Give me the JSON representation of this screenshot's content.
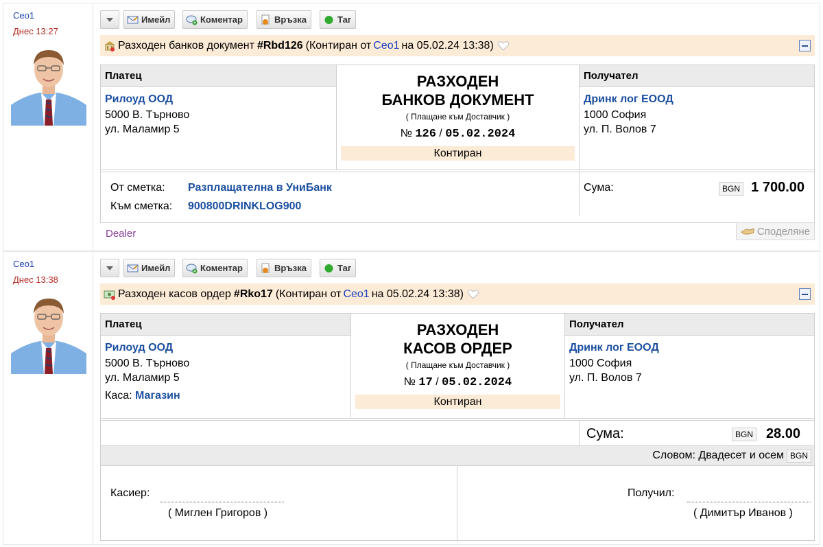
{
  "entries": [
    {
      "author": "Ceo1",
      "time": "Днес 13:27",
      "toolbar": {
        "email": "Имейл",
        "comment": "Коментар",
        "link": "Връзка",
        "tag": "Таг"
      },
      "header": {
        "doc_type": "Разходен банков документ",
        "doc_id": "#Rbd126",
        "status_prefix": "(Контиран от",
        "user": "Ceo1",
        "on": "на 05.02.24 13:38)"
      },
      "payer": {
        "head": "Платец",
        "name": "Рилоуд ООД",
        "line1": "5000 В. Търново",
        "line2": "ул. Маламир 5"
      },
      "title1": "РАЗХОДЕН",
      "title2": "БАНКОВ ДОКУМЕНТ",
      "subtitle": "( Плащане към Доставчик )",
      "num_sign": "№",
      "number": "126",
      "slash": "/",
      "date": "05.02.2024",
      "state": "Контиран",
      "recipient": {
        "head": "Получател",
        "name": "Дринк лог ЕООД",
        "line1": "1000 София",
        "line2": "ул. П. Волов 7"
      },
      "from_label": "От сметка:",
      "from_value": "Разплащателна в УниБанк",
      "to_label": "Към сметка:",
      "to_value": "900800DRINKLOG900",
      "sum_label": "Сума:",
      "currency": "BGN",
      "amount": "1 700.00",
      "dealer": "Dealer",
      "share": "Споделяне"
    },
    {
      "author": "Ceo1",
      "time": "Днес 13:38",
      "toolbar": {
        "email": "Имейл",
        "comment": "Коментар",
        "link": "Връзка",
        "tag": "Таг"
      },
      "header": {
        "doc_type": "Разходен касов ордер",
        "doc_id": "#Rko17",
        "status_prefix": "(Контиран от",
        "user": "Ceo1",
        "on": "на 05.02.24 13:38)"
      },
      "payer": {
        "head": "Платец",
        "name": "Рилоуд ООД",
        "line1": "5000 В. Търново",
        "line2": "ул. Маламир 5",
        "cash_label": "Каса:",
        "cash_value": "Магазин"
      },
      "title1": "РАЗХОДЕН",
      "title2": "КАСОВ ОРДЕР",
      "subtitle": "( Плащане към Доставчик )",
      "num_sign": "№",
      "number": "17",
      "slash": "/",
      "date": "05.02.2024",
      "state": "Контиран",
      "recipient": {
        "head": "Получател",
        "name": "Дринк лог ЕООД",
        "line1": "1000 София",
        "line2": "ул. П. Волов 7"
      },
      "sum_label": "Сума:",
      "currency": "BGN",
      "amount": "28.00",
      "words_label": "Словом: Двадесет и осем",
      "words_currency": "BGN",
      "cashier_label": "Касиер:",
      "cashier_name": "( Миглен Григоров )",
      "received_label": "Получил:",
      "received_name": "( Димитър Иванов )"
    }
  ],
  "colors": {
    "link": "#1a3fbf",
    "time": "#b3261e",
    "banner": "#fcebd6",
    "accent": "#1c4fa0",
    "dealer": "#8a3f9c"
  },
  "icons": [
    "dropdown-arrow-icon",
    "email-icon",
    "comment-icon",
    "link-icon",
    "tag-icon",
    "bank-document-icon",
    "cash-order-icon",
    "heart-icon",
    "collapse-icon",
    "share-icon"
  ]
}
